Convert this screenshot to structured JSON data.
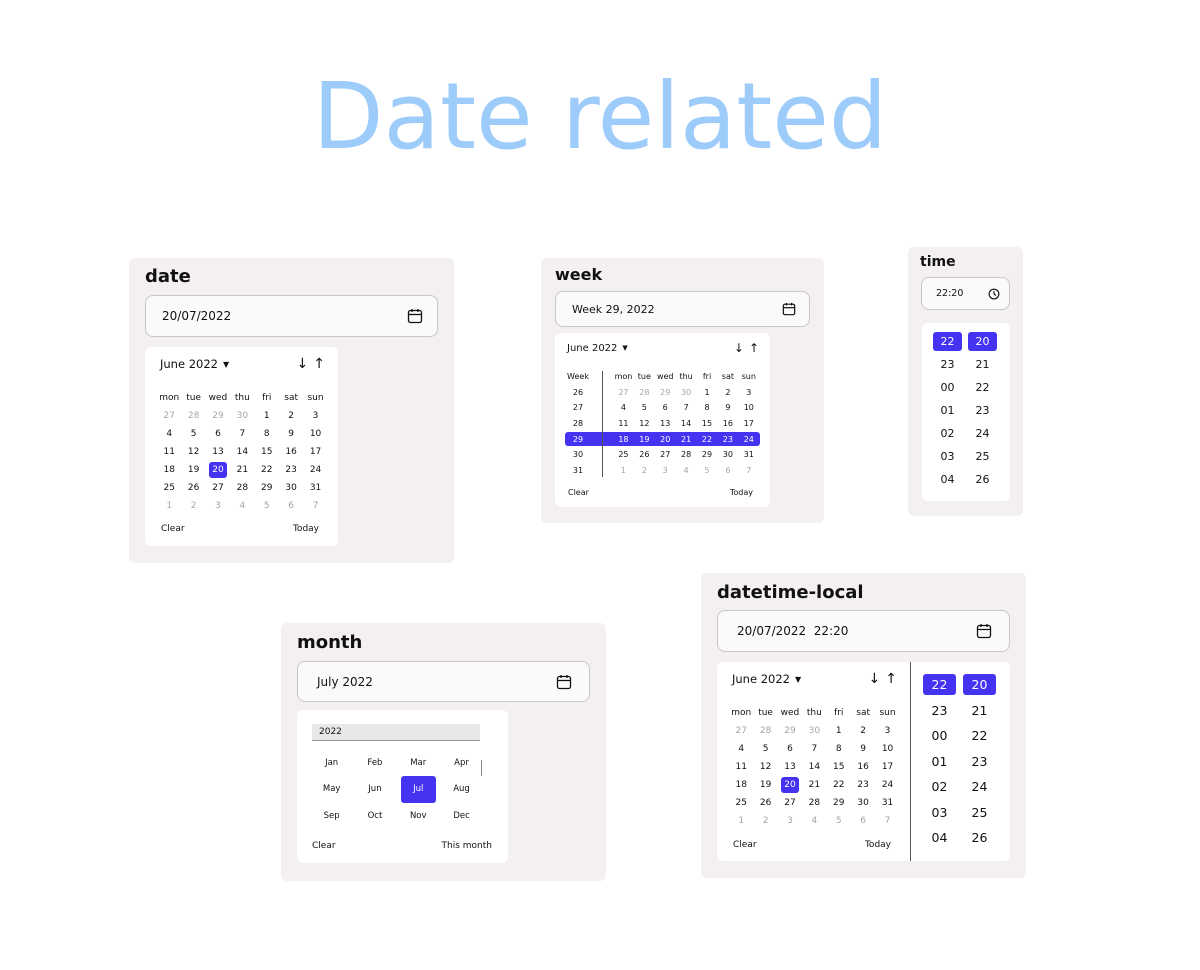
{
  "page_title": "Date related",
  "colors": {
    "accent": "#4433f0",
    "title": "#9dccfb",
    "card_bg": "#f4eff0"
  },
  "date_picker": {
    "label": "date",
    "value": "20/07/2022",
    "icon": "calendar-icon",
    "month_label": "June 2022",
    "weekdays": [
      "mon",
      "tue",
      "wed",
      "thu",
      "fri",
      "sat",
      "sun"
    ],
    "days": [
      [
        "27",
        "28",
        "29",
        "30",
        "1",
        "2",
        "3"
      ],
      [
        "4",
        "5",
        "6",
        "7",
        "8",
        "9",
        "10"
      ],
      [
        "11",
        "12",
        "13",
        "14",
        "15",
        "16",
        "17"
      ],
      [
        "18",
        "19",
        "20",
        "21",
        "22",
        "23",
        "24"
      ],
      [
        "25",
        "26",
        "27",
        "28",
        "29",
        "30",
        "31"
      ],
      [
        "1",
        "2",
        "3",
        "4",
        "5",
        "6",
        "7"
      ]
    ],
    "clear": "Clear",
    "today": "Today"
  },
  "week_picker": {
    "label": "week",
    "value": "Week 29, 2022",
    "icon": "calendar-icon",
    "month_label": "June 2022",
    "week_header": "Week",
    "weekdays": [
      "mon",
      "tue",
      "wed",
      "thu",
      "fri",
      "sat",
      "sun"
    ],
    "weeks": [
      "26",
      "27",
      "28",
      "29",
      "30",
      "31"
    ],
    "days": [
      [
        "27",
        "28",
        "29",
        "30",
        "1",
        "2",
        "3"
      ],
      [
        "4",
        "5",
        "6",
        "7",
        "8",
        "9",
        "10"
      ],
      [
        "11",
        "12",
        "13",
        "14",
        "15",
        "16",
        "17"
      ],
      [
        "18",
        "19",
        "20",
        "21",
        "22",
        "23",
        "24"
      ],
      [
        "25",
        "26",
        "27",
        "28",
        "29",
        "30",
        "31"
      ],
      [
        "1",
        "2",
        "3",
        "4",
        "5",
        "6",
        "7"
      ]
    ],
    "clear": "Clear",
    "today": "Today"
  },
  "time_picker": {
    "label": "time",
    "value": "22:20",
    "icon": "clock-icon",
    "hours": [
      "22",
      "23",
      "00",
      "01",
      "02",
      "03",
      "04"
    ],
    "minutes": [
      "20",
      "21",
      "22",
      "23",
      "24",
      "25",
      "26"
    ]
  },
  "month_picker": {
    "label": "month",
    "value": "July 2022",
    "icon": "calendar-icon",
    "year": "2022",
    "months": [
      "Jan",
      "Feb",
      "Mar",
      "Apr",
      "May",
      "Jun",
      "Jul",
      "Aug",
      "Sep",
      "Oct",
      "Nov",
      "Dec"
    ],
    "clear": "Clear",
    "this_month": "This month"
  },
  "datetime_picker": {
    "label": "datetime-local",
    "value": "20/07/2022  22:20",
    "icon": "calendar-icon",
    "month_label": "June 2022",
    "weekdays": [
      "mon",
      "tue",
      "wed",
      "thu",
      "fri",
      "sat",
      "sun"
    ],
    "days": [
      [
        "27",
        "28",
        "29",
        "30",
        "1",
        "2",
        "3"
      ],
      [
        "4",
        "5",
        "6",
        "7",
        "8",
        "9",
        "10"
      ],
      [
        "11",
        "12",
        "13",
        "14",
        "15",
        "16",
        "17"
      ],
      [
        "18",
        "19",
        "20",
        "21",
        "22",
        "23",
        "24"
      ],
      [
        "25",
        "26",
        "27",
        "28",
        "29",
        "30",
        "31"
      ],
      [
        "1",
        "2",
        "3",
        "4",
        "5",
        "6",
        "7"
      ]
    ],
    "hours": [
      "22",
      "23",
      "00",
      "01",
      "02",
      "03",
      "04"
    ],
    "minutes": [
      "20",
      "21",
      "22",
      "23",
      "24",
      "25",
      "26"
    ],
    "clear": "Clear",
    "today": "Today"
  }
}
